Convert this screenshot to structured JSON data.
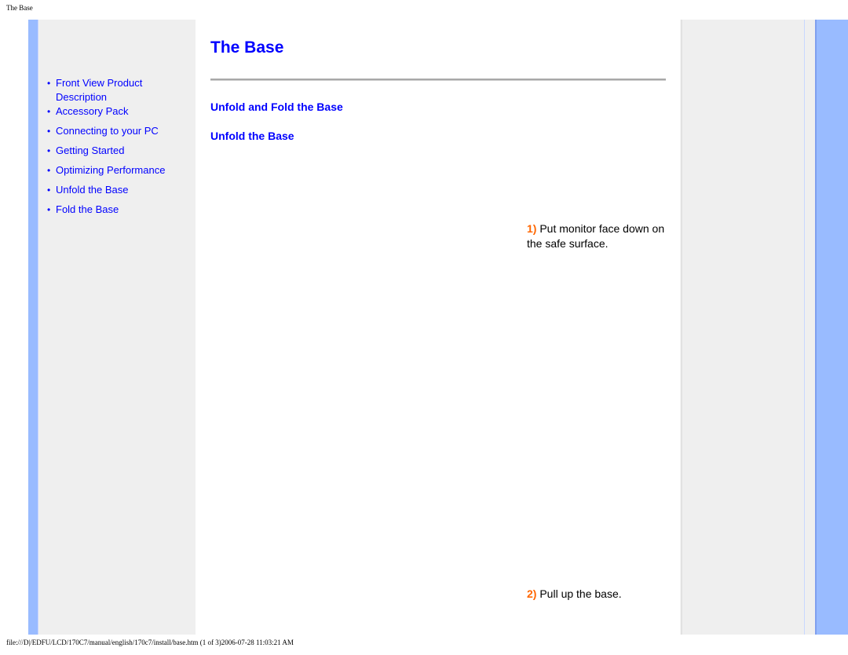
{
  "header": {
    "title": "The Base"
  },
  "sidebar": {
    "items": [
      {
        "label": "Front View Product Description"
      },
      {
        "label": "Accessory Pack"
      },
      {
        "label": "Connecting to your PC"
      },
      {
        "label": "Getting Started"
      },
      {
        "label": "Optimizing Performance"
      },
      {
        "label": "Unfold the Base"
      },
      {
        "label": "Fold the Base"
      }
    ],
    "bullet": "•"
  },
  "main": {
    "title": "The Base",
    "section_heading": "Unfold and Fold the Base",
    "subsection_heading": "Unfold the Base",
    "steps": [
      {
        "number": "1)",
        "text": " Put monitor face down on the safe surface."
      },
      {
        "number": "2)",
        "text": " Pull up the base."
      }
    ]
  },
  "footer": {
    "text": "file:///D|/EDFU/LCD/170C7/manual/english/170c7/install/base.htm (1 of 3)2006-07-28 11:03:21 AM"
  },
  "colors": {
    "link": "#0000ff",
    "step_number": "#ff6600",
    "sidebar_strip": "#99bbff",
    "panel_bg": "#efefef"
  }
}
